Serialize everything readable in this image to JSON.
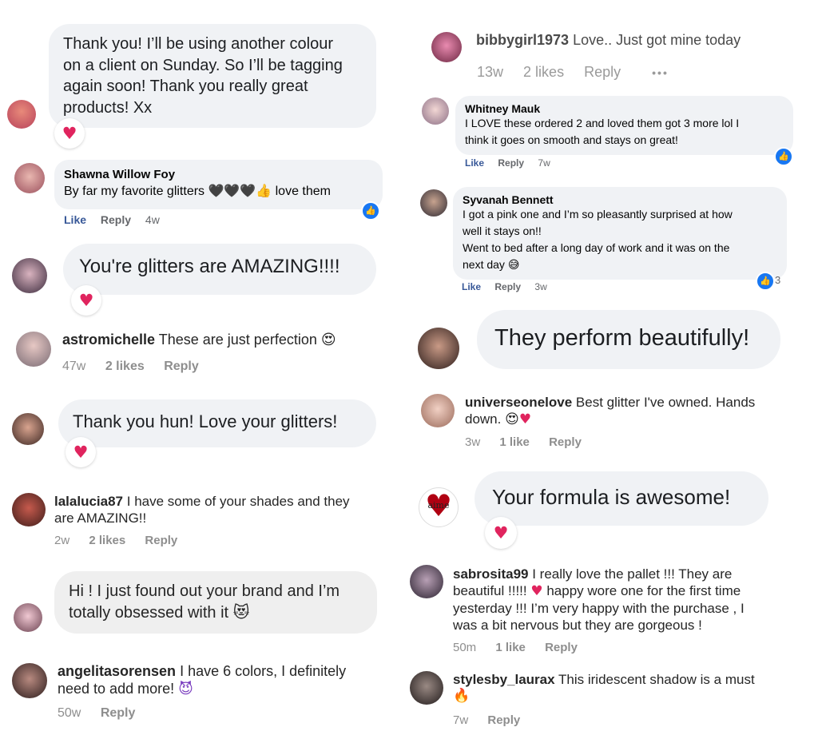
{
  "colors": {
    "heart": "#e0245e",
    "fb_like_blue": "#1877f2",
    "fb_link": "#385898",
    "meta_gray": "#8e8e8e",
    "bubble_gray": "#efefef"
  },
  "icons": {
    "heart": "♥",
    "like": "👍",
    "thumbs": "👍",
    "grin": "😅",
    "heart_eyes": "😍",
    "cat_smile": "😻",
    "devil": "😈",
    "fire": "🔥"
  },
  "left": [
    {
      "type": "reply-bubble",
      "text_lines": [
        "Thank you! I’ll be using another colour",
        "on a client on Sunday. So I’ll be tagging",
        "again soon! Thank you really great",
        "products!  Xx"
      ],
      "reaction": "♥"
    },
    {
      "type": "fb-comment",
      "name": "Shawna Willow Foy",
      "text": "By far my favorite glitters 🖤🖤🖤👍 love them",
      "like": "Like",
      "reply": "Reply",
      "time": "4w"
    },
    {
      "type": "reply-bubble",
      "text": "You're glitters are AMAZING!!!!",
      "reaction": "♥"
    },
    {
      "type": "ig-comment",
      "username": "astromichelle",
      "text": "These are just perfection",
      "time": "47w",
      "likes": "2 likes",
      "reply": "Reply"
    },
    {
      "type": "reply-bubble",
      "text": "Thank you hun! Love your glitters!",
      "reaction": "♥"
    },
    {
      "type": "ig-comment",
      "username": "lalalucia87",
      "line1": "I have some of your shades and they",
      "line2": "are AMAZING!!",
      "time": "2w",
      "likes": "2 likes",
      "reply": "Reply"
    },
    {
      "type": "ig-bubble",
      "line1": "Hi ! I just found out your brand and I’m",
      "line2": "totally obsessed with it"
    },
    {
      "type": "ig-comment",
      "username": "angelitasorensen",
      "line1": "I have 6 colors, I definitely",
      "line2": "need to add more!",
      "time": "50w",
      "reply": "Reply"
    }
  ],
  "right": [
    {
      "type": "ig-comment",
      "username": "bibbygirl1973",
      "text": "Love.. Just got mine today",
      "time": "13w",
      "likes": "2 likes",
      "reply": "Reply",
      "more": "•••"
    },
    {
      "type": "fb-comment",
      "name": "Whitney Mauk",
      "line1": "I LOVE these ordered 2 and loved them got 3 more lol I",
      "line2": "think it goes on smooth and stays on great!",
      "like": "Like",
      "reply": "Reply",
      "time": "7w"
    },
    {
      "type": "fb-comment",
      "name": "Syvanah Bennett",
      "line1": "I got a pink one and I’m so pleasantly surprised at how",
      "line2": "well it stays on!!",
      "line3": "Went to bed after a long day of work and it was on the",
      "line4": "next day",
      "like": "Like",
      "reply": "Reply",
      "time": "3w",
      "reaction_count": "3"
    },
    {
      "type": "reply-bubble",
      "text": "They perform beautifully!"
    },
    {
      "type": "ig-comment",
      "username": "universeonelove",
      "line1": "Best glitter I've owned. Hands",
      "line2": "down.",
      "time": "3w",
      "likes": "1 like",
      "reply": "Reply"
    },
    {
      "type": "reply-bubble",
      "text": "Your formula is awesome!",
      "reaction": "♥",
      "avatar_text": "aime"
    },
    {
      "type": "ig-comment",
      "username": "sabrosita99",
      "line1": "I really love the pallet !!! They are",
      "line2": "beautiful !!!!!",
      "line2b": "happy wore one for the first time",
      "line3": "yesterday !!! I’m very happy with the purchase , I",
      "line4": "was a bit nervous but they are gorgeous !",
      "time": "50m",
      "likes": "1 like",
      "reply": "Reply"
    },
    {
      "type": "ig-comment",
      "username": "stylesby_laurax",
      "text": "This iridescent shadow is a must",
      "time": "7w",
      "reply": "Reply"
    }
  ]
}
